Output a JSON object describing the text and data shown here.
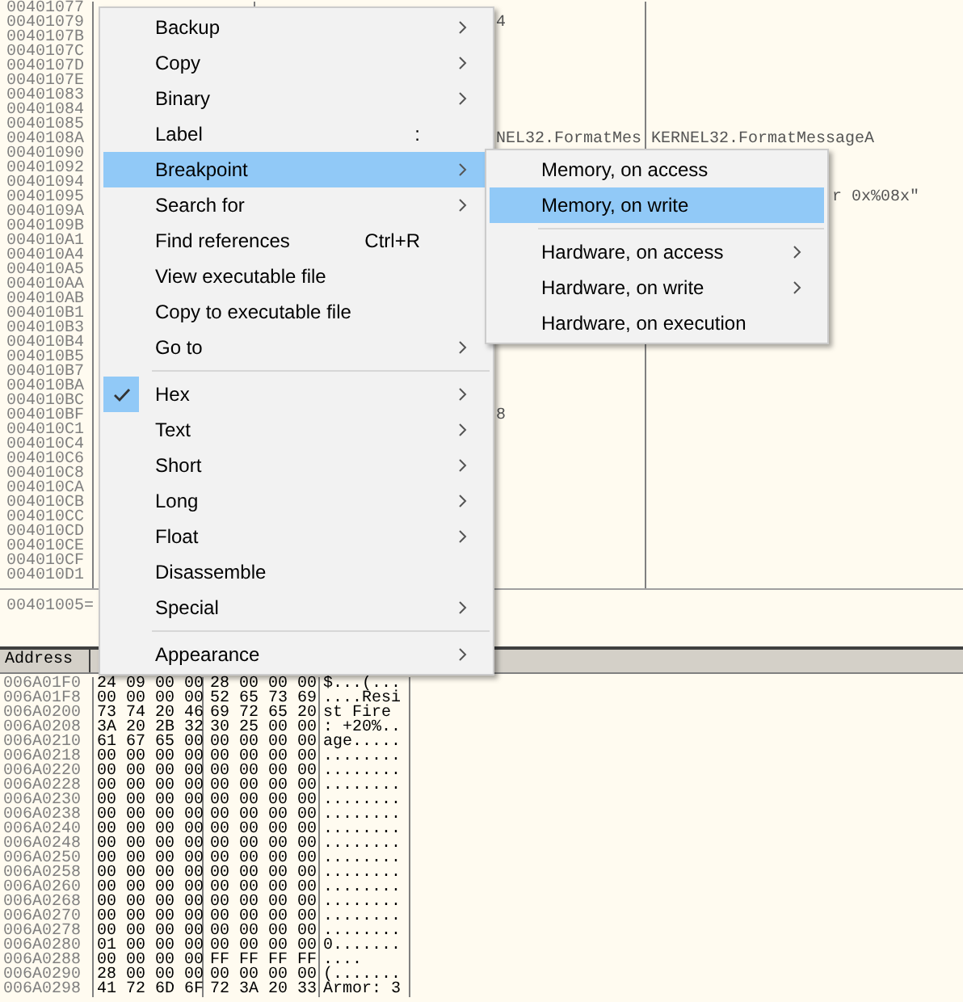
{
  "disassembly": {
    "rows": [
      {
        "address": "00401077"
      },
      {
        "address": "00401079",
        "column_2": "4"
      },
      {
        "address": "0040107B"
      },
      {
        "address": "0040107C"
      },
      {
        "address": "0040107D"
      },
      {
        "address": "0040107E"
      },
      {
        "address": "00401083"
      },
      {
        "address": "00401084"
      },
      {
        "address": "00401085"
      },
      {
        "address": "0040108A",
        "column_2": "NEL32.FormatMes",
        "column_3": "KERNEL32.FormatMessageA"
      },
      {
        "address": "00401090"
      },
      {
        "address": "00401092"
      },
      {
        "address": "00401094"
      },
      {
        "address": "00401095",
        "column_3": "r 0x%08x\""
      },
      {
        "address": "0040109A"
      },
      {
        "address": "0040109B"
      },
      {
        "address": "004010A1"
      },
      {
        "address": "004010A4"
      },
      {
        "address": "004010A5"
      },
      {
        "address": "004010AA"
      },
      {
        "address": "004010AB"
      },
      {
        "address": "004010B1"
      },
      {
        "address": "004010B3"
      },
      {
        "address": "004010B4"
      },
      {
        "address": "004010B5"
      },
      {
        "address": "004010B7"
      },
      {
        "address": "004010BA"
      },
      {
        "address": "004010BC"
      },
      {
        "address": "004010BF",
        "column_2": "8"
      },
      {
        "address": "004010C1"
      },
      {
        "address": "004010C4"
      },
      {
        "address": "004010C6"
      },
      {
        "address": "004010C8"
      },
      {
        "address": "004010CA"
      },
      {
        "address": "004010CB"
      },
      {
        "address": "004010CC"
      },
      {
        "address": "004010CD"
      },
      {
        "address": "004010CE"
      },
      {
        "address": "004010CF"
      },
      {
        "address": "004010D1"
      }
    ]
  },
  "info_pane": {
    "text": "00401005="
  },
  "dump": {
    "header": "Address",
    "rows": [
      {
        "address": "006A01F0",
        "hex_1": "24 09 00 00",
        "hex_2": "28 00 00 00",
        "ascii": "$...(..."
      },
      {
        "address": "006A01F8",
        "hex_1": "00 00 00 00",
        "hex_2": "52 65 73 69",
        "ascii": "....Resi"
      },
      {
        "address": "006A0200",
        "hex_1": "73 74 20 46",
        "hex_2": "69 72 65 20",
        "ascii": "st Fire"
      },
      {
        "address": "006A0208",
        "hex_1": "3A 20 2B 32",
        "hex_2": "30 25 00 00",
        "ascii": ": +20%.."
      },
      {
        "address": "006A0210",
        "hex_1": "61 67 65 00",
        "hex_2": "00 00 00 00",
        "ascii": "age....."
      },
      {
        "address": "006A0218",
        "hex_1": "00 00 00 00",
        "hex_2": "00 00 00 00",
        "ascii": "........"
      },
      {
        "address": "006A0220",
        "hex_1": "00 00 00 00",
        "hex_2": "00 00 00 00",
        "ascii": "........"
      },
      {
        "address": "006A0228",
        "hex_1": "00 00 00 00",
        "hex_2": "00 00 00 00",
        "ascii": "........"
      },
      {
        "address": "006A0230",
        "hex_1": "00 00 00 00",
        "hex_2": "00 00 00 00",
        "ascii": "........"
      },
      {
        "address": "006A0238",
        "hex_1": "00 00 00 00",
        "hex_2": "00 00 00 00",
        "ascii": "........"
      },
      {
        "address": "006A0240",
        "hex_1": "00 00 00 00",
        "hex_2": "00 00 00 00",
        "ascii": "........"
      },
      {
        "address": "006A0248",
        "hex_1": "00 00 00 00",
        "hex_2": "00 00 00 00",
        "ascii": "........"
      },
      {
        "address": "006A0250",
        "hex_1": "00 00 00 00",
        "hex_2": "00 00 00 00",
        "ascii": "........"
      },
      {
        "address": "006A0258",
        "hex_1": "00 00 00 00",
        "hex_2": "00 00 00 00",
        "ascii": "........"
      },
      {
        "address": "006A0260",
        "hex_1": "00 00 00 00",
        "hex_2": "00 00 00 00",
        "ascii": "........"
      },
      {
        "address": "006A0268",
        "hex_1": "00 00 00 00",
        "hex_2": "00 00 00 00",
        "ascii": "........"
      },
      {
        "address": "006A0270",
        "hex_1": "00 00 00 00",
        "hex_2": "00 00 00 00",
        "ascii": "........"
      },
      {
        "address": "006A0278",
        "hex_1": "00 00 00 00",
        "hex_2": "00 00 00 00",
        "ascii": "........"
      },
      {
        "address": "006A0280",
        "hex_1": "01 00 00 00",
        "hex_2": "00 00 00 00",
        "ascii": "0......."
      },
      {
        "address": "006A0288",
        "hex_1": "00 00 00 00",
        "hex_2": "FF FF FF FF",
        "ascii": "...."
      },
      {
        "address": "006A0290",
        "hex_1": "28 00 00 00",
        "hex_2": "00 00 00 00",
        "ascii": "(......."
      },
      {
        "address": "006A0298",
        "hex_1": "41 72 6D 6F",
        "hex_2": "72 3A 20 33",
        "ascii": "Armor: 3"
      }
    ]
  },
  "context_menu": {
    "items": [
      {
        "kind": "item",
        "label": "Backup",
        "submenu": true,
        "selected": false
      },
      {
        "kind": "item",
        "label": "Copy",
        "submenu": true,
        "selected": false
      },
      {
        "kind": "item",
        "label": "Binary",
        "submenu": true,
        "selected": false
      },
      {
        "kind": "item",
        "label": "Label",
        "shortcut": ":",
        "submenu": false,
        "selected": false
      },
      {
        "kind": "item",
        "label": "Breakpoint",
        "submenu": true,
        "selected": true
      },
      {
        "kind": "item",
        "label": "Search for",
        "submenu": true,
        "selected": false
      },
      {
        "kind": "item",
        "label": "Find references",
        "shortcut": "Ctrl+R",
        "submenu": false,
        "selected": false
      },
      {
        "kind": "item",
        "label": "View executable file",
        "submenu": false,
        "selected": false
      },
      {
        "kind": "item",
        "label": "Copy to executable file",
        "submenu": false,
        "selected": false
      },
      {
        "kind": "item",
        "label": "Go to",
        "submenu": true,
        "selected": false
      },
      {
        "kind": "separator"
      },
      {
        "kind": "item",
        "label": "Hex",
        "submenu": true,
        "selected": false,
        "checked": true
      },
      {
        "kind": "item",
        "label": "Text",
        "submenu": true,
        "selected": false,
        "checked": false
      },
      {
        "kind": "item",
        "label": "Short",
        "submenu": true,
        "selected": false,
        "checked": false
      },
      {
        "kind": "item",
        "label": "Long",
        "submenu": true,
        "selected": false,
        "checked": false
      },
      {
        "kind": "item",
        "label": "Float",
        "submenu": true,
        "selected": false,
        "checked": false
      },
      {
        "kind": "item",
        "label": "Disassemble",
        "submenu": false,
        "selected": false,
        "checked": false
      },
      {
        "kind": "item",
        "label": "Special",
        "submenu": true,
        "selected": false
      },
      {
        "kind": "separator"
      },
      {
        "kind": "item",
        "label": "Appearance",
        "submenu": true,
        "selected": false
      }
    ]
  },
  "submenu": {
    "items": [
      {
        "kind": "item",
        "label": "Memory, on access",
        "submenu": false,
        "selected": false
      },
      {
        "kind": "item",
        "label": "Memory, on write",
        "submenu": false,
        "selected": true
      },
      {
        "kind": "separator"
      },
      {
        "kind": "item",
        "label": "Hardware, on access",
        "submenu": true,
        "selected": false
      },
      {
        "kind": "item",
        "label": "Hardware, on write",
        "submenu": true,
        "selected": false
      },
      {
        "kind": "item",
        "label": "Hardware, on execution",
        "submenu": false,
        "selected": false
      }
    ]
  }
}
